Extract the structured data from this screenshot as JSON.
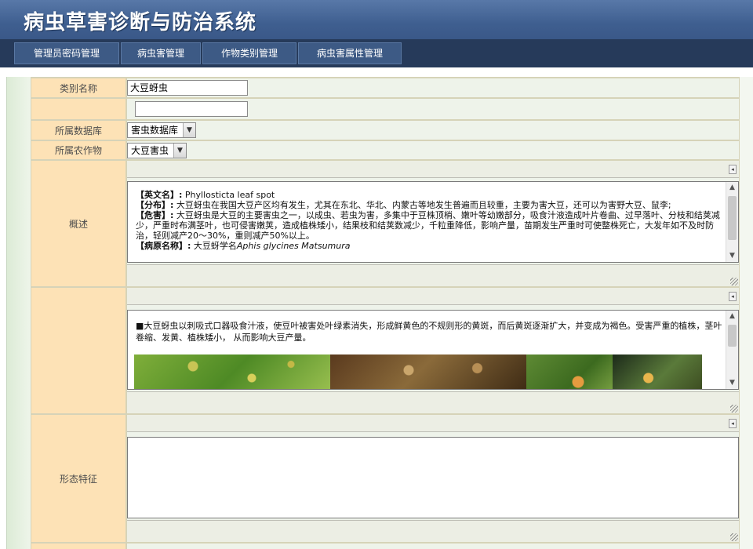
{
  "app": {
    "title": "病虫草害诊断与防治系统"
  },
  "nav": {
    "tabs": [
      {
        "label": "管理员密码管理"
      },
      {
        "label": "病虫害管理"
      },
      {
        "label": "作物类别管理"
      },
      {
        "label": "病虫害属性管理"
      }
    ]
  },
  "form": {
    "category_name": {
      "label": "类别名称",
      "value": "大豆蚜虫"
    },
    "second_field": {
      "value": ""
    },
    "database": {
      "label": "所属数据库",
      "selected": "害虫数据库"
    },
    "crop": {
      "label": "所属农作物",
      "selected": "大豆害虫"
    },
    "overview": {
      "label": "概述",
      "lines": [
        {
          "key": "【英文名】:",
          "text": " Phyllosticta leaf spot"
        },
        {
          "key": "【分布】:",
          "text": " 大豆蚜虫在我国大豆产区均有发生，尤其在东北、华北、内蒙古等地发生普遍而且较重，主要为害大豆，还可以为害野大豆、鼠李;"
        },
        {
          "key": "【危害】:",
          "text": " 大豆蚜虫是大豆的主要害虫之一，以成虫、若虫为害，多集中于豆株顶梢、嫩叶等幼嫩部分，吸食汁液造成叶片卷曲、过早落叶、分枝和结荚减少，严重时布满茎叶，也可侵害嫩荚，造成植株矮小，结果枝和结荚数减少，千粒重降低，影响产量，苗期发生严重时可使整株死亡，大发年如不及时防治，轻则减产20～30%，重则减产50%以上。"
        },
        {
          "key": "【病原名称】:",
          "text": " 大豆蚜学名",
          "italic": "Aphis glycines Matsumura"
        }
      ]
    },
    "symptom": {
      "text": "■大豆蚜虫以刺吸式口器吸食汁液，使豆叶被害处叶绿素消失，形成鲜黄色的不规则形的黄斑，而后黄斑逐渐扩大，并变成为褐色。受害严重的植株，茎叶卷缩、发黄、植株矮小，                              从而影响大豆产量。"
    },
    "morphology": {
      "label": "形态特征",
      "text": ""
    }
  }
}
